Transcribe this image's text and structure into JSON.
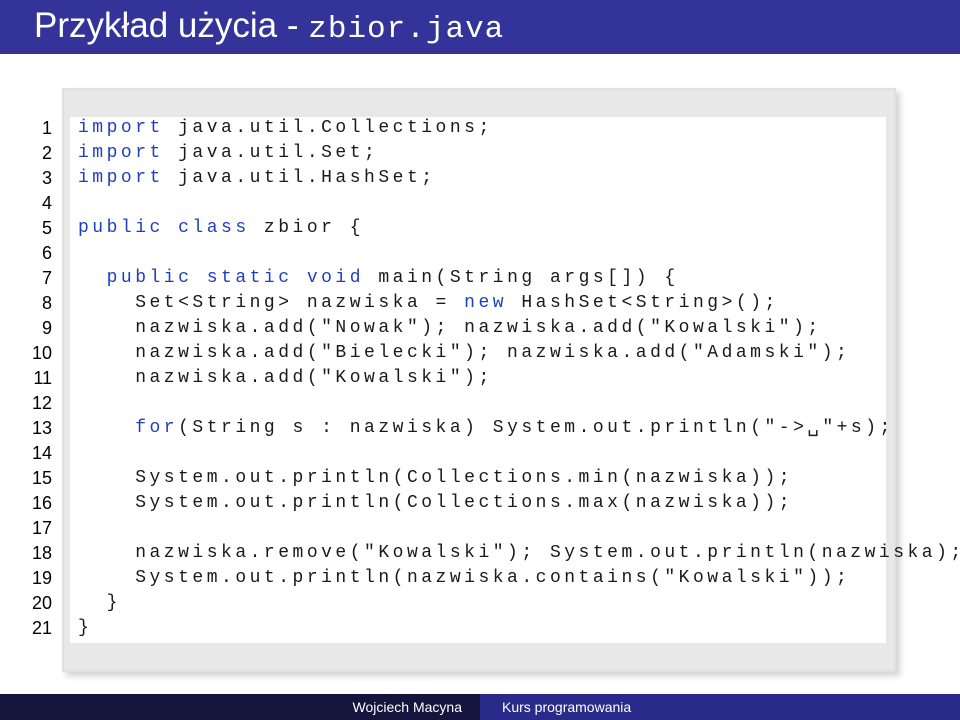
{
  "slide": {
    "title_text": "Przykład użycia - ",
    "title_file": "zbior.java"
  },
  "line_numbers": [
    "1",
    "2",
    "3",
    "4",
    "5",
    "6",
    "7",
    "8",
    "9",
    "10",
    "11",
    "12",
    "13",
    "14",
    "15",
    "16",
    "17",
    "18",
    "19",
    "20",
    "21"
  ],
  "code": {
    "l1_kw": "import",
    "l1_rest": " java.util.Collections;",
    "l2_kw": "import",
    "l2_rest": " java.util.Set;",
    "l3_kw": "import",
    "l3_rest": " java.util.HashSet;",
    "l5_kw": "public class",
    "l5_rest": " zbior {",
    "l7_kw": "  public static void",
    "l7_rest": " main(String args[]) {",
    "l8_a": "    Set<String> nazwiska = ",
    "l8_kw": "new",
    "l8_b": " HashSet<String>();",
    "l9": "    nazwiska.add(\"Nowak\"); nazwiska.add(\"Kowalski\");",
    "l10": "    nazwiska.add(\"Bielecki\"); nazwiska.add(\"Adamski\");",
    "l11": "    nazwiska.add(\"Kowalski\");",
    "l13_kw": "    for",
    "l13_rest": "(String s : nazwiska) System.out.println(\"->␣\"+s);",
    "l15": "    System.out.println(Collections.min(nazwiska));",
    "l16": "    System.out.println(Collections.max(nazwiska));",
    "l18": "    nazwiska.remove(\"Kowalski\"); System.out.println(nazwiska);",
    "l19": "    System.out.println(nazwiska.contains(\"Kowalski\"));",
    "l20": "  }",
    "l21": "}"
  },
  "footer": {
    "author": "Wojciech Macyna",
    "course": "Kurs programowania"
  },
  "colors": {
    "title_bar": "#333399",
    "keyword": "#1f3fbf",
    "footer_left": "#14143c",
    "footer_right": "#2a2a8a"
  }
}
